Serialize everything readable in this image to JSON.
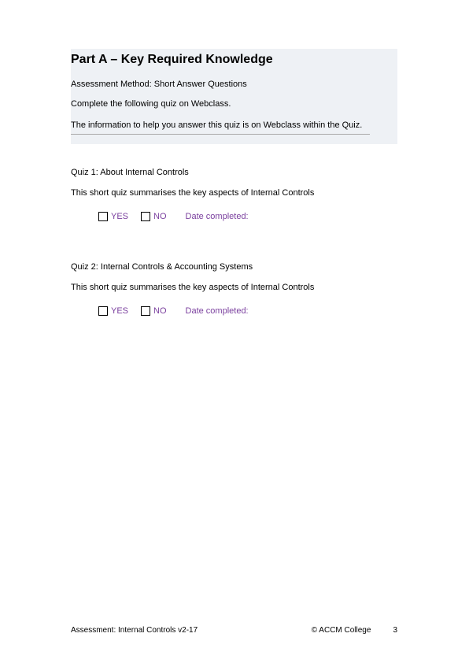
{
  "header": {
    "title": "Part A – Key Required Knowledge",
    "subtitle": "Assessment Method: Short Answer Questions",
    "instruction": "Complete the following quiz on Webclass.",
    "info": "The information to help you answer this quiz is on Webclass within the Quiz."
  },
  "quizzes": [
    {
      "title": "Quiz 1: About Internal Controls",
      "desc": "This short quiz summarises the key aspects of Internal Controls",
      "yes_label": "YES",
      "no_label": "NO",
      "date_label": "Date completed:"
    },
    {
      "title": "Quiz 2: Internal Controls & Accounting Systems",
      "desc": "This short quiz summarises the key aspects of Internal Controls",
      "yes_label": "YES",
      "no_label": "NO",
      "date_label": "Date completed:"
    }
  ],
  "footer": {
    "left": "Assessment: Internal Controls v2-17",
    "copyright": "© ACCM College",
    "page_number": "3"
  },
  "colors": {
    "accent": "#7a3f9e",
    "header_bg": "#eef1f5"
  }
}
